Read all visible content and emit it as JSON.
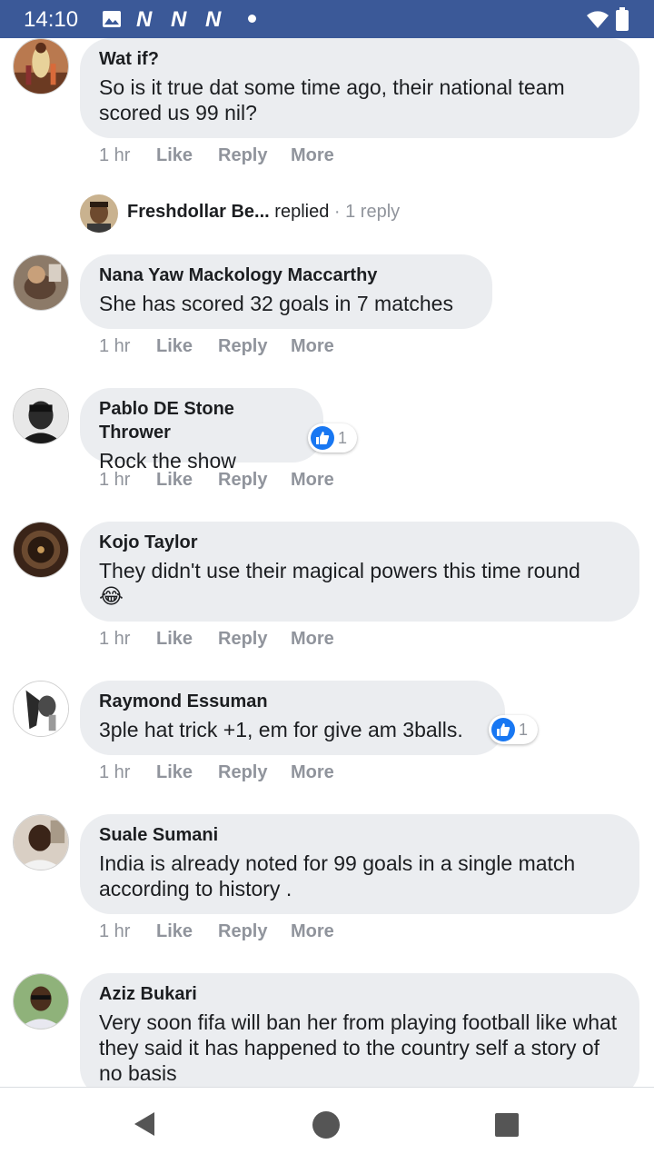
{
  "status_bar": {
    "time": "14:10",
    "notif_letter": "N"
  },
  "threads": [
    {
      "author": "Wat if?",
      "text": "So is it true dat some time ago, their national team scored us 99 nil?",
      "meta": {
        "time": "1 hr",
        "like": "Like",
        "reply": "Reply",
        "more": "More"
      }
    },
    {
      "author": "Nana Yaw Mackology Maccarthy",
      "text": "She has scored 32 goals in 7 matches",
      "meta": {
        "time": "1 hr",
        "like": "Like",
        "reply": "Reply",
        "more": "More"
      }
    },
    {
      "author": "Pablo DE Stone Thrower",
      "text": "Rock the show",
      "reactions": "1",
      "meta": {
        "time": "1 hr",
        "like": "Like",
        "reply": "Reply",
        "more": "More"
      }
    },
    {
      "author": "Kojo Taylor",
      "text": "They didn't use their magical powers this time round",
      "emoji": "😂",
      "meta": {
        "time": "1 hr",
        "like": "Like",
        "reply": "Reply",
        "more": "More"
      }
    },
    {
      "author": "Raymond Essuman",
      "text": "3ple hat trick +1, em for give am 3balls.",
      "reactions": "1",
      "meta": {
        "time": "1 hr",
        "like": "Like",
        "reply": "Reply",
        "more": "More"
      }
    },
    {
      "author": "Suale Sumani",
      "text": "India is already noted for 99 goals in a single match according to history .",
      "meta": {
        "time": "1 hr",
        "like": "Like",
        "reply": "Reply",
        "more": "More"
      }
    },
    {
      "author": "Aziz Bukari",
      "text": "Very soon fifa will ban her from playing football like what they said it has happened to the country self a story of no basis"
    }
  ],
  "replied_row": {
    "name": "Freshdollar Be...",
    "action": "replied",
    "separator": "·",
    "count": "1 reply"
  },
  "nav": {
    "back_icon": "back-icon",
    "home_icon": "home-icon",
    "recents_icon": "recents-icon"
  }
}
